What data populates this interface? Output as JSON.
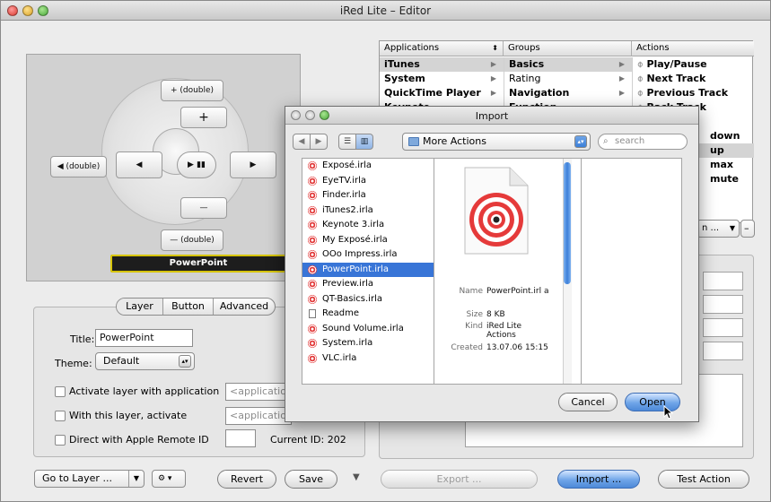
{
  "window": {
    "title": "iRed Lite – Editor"
  },
  "remote": {
    "plus_double": "+ (double)",
    "plus": "+",
    "left_double": "◀ (double)",
    "left": "◀",
    "play_pause": "▶ ▮▮",
    "right": "▶",
    "minus": "—",
    "minus_double": "— (double)",
    "layer_name": "PowerPoint"
  },
  "tabs": [
    "Layer",
    "Button",
    "Advanced"
  ],
  "layer_form": {
    "title_label": "Title:",
    "title_value": "PowerPoint",
    "theme_label": "Theme:",
    "theme_value": "Default",
    "activate_label": "Activate layer with application",
    "activate_placeholder": "<application",
    "with_layer_label": "With this layer, activate",
    "with_layer_placeholder": "<application",
    "direct_label": "Direct with Apple Remote ID",
    "current_id_label": "Current ID: 202"
  },
  "bottom_bar": {
    "goto": "Go to Layer ...",
    "revert": "Revert",
    "save": "Save",
    "export": "Export ...",
    "import": "Import ...",
    "test": "Test Action"
  },
  "browser": {
    "col1_header": "Applications",
    "col2_header": "Groups",
    "col3_header": "Actions",
    "applications": [
      "iTunes",
      "System",
      "QuickTime Player",
      "Keynote"
    ],
    "groups": [
      "Basics",
      "Rating",
      "Navigation",
      "Function"
    ],
    "actions": [
      "Play/Pause",
      "Next Track",
      "Previous Track",
      "Back Track"
    ],
    "actions_partial": [
      "down",
      "up",
      "max",
      "mute"
    ],
    "popup_partial": "n ..."
  },
  "dialog": {
    "title": "Import",
    "location": "More Actions",
    "search_placeholder": "search",
    "files": [
      "Exposé.irla",
      "EyeTV.irla",
      "Finder.irla",
      "iTunes2.irla",
      "Keynote 3.irla",
      "My Exposé.irla",
      "OOo Impress.irla",
      "PowerPoint.irla",
      "Preview.irla",
      "QT-Basics.irla",
      "Readme",
      "Sound Volume.irla",
      "System.irla",
      "VLC.irla"
    ],
    "selected_file": "PowerPoint.irla",
    "meta": {
      "name_label": "Name",
      "name_value": "PowerPoint.irl a",
      "size_label": "Size",
      "size_value": "8 KB",
      "kind_label": "Kind",
      "kind_value": "iRed Lite Actions",
      "created_label": "Created",
      "created_value": "13.07.06 15:15"
    },
    "cancel": "Cancel",
    "open": "Open"
  },
  "colors": {
    "accent": "#3875d7",
    "layer_outline": "#d6c400"
  }
}
